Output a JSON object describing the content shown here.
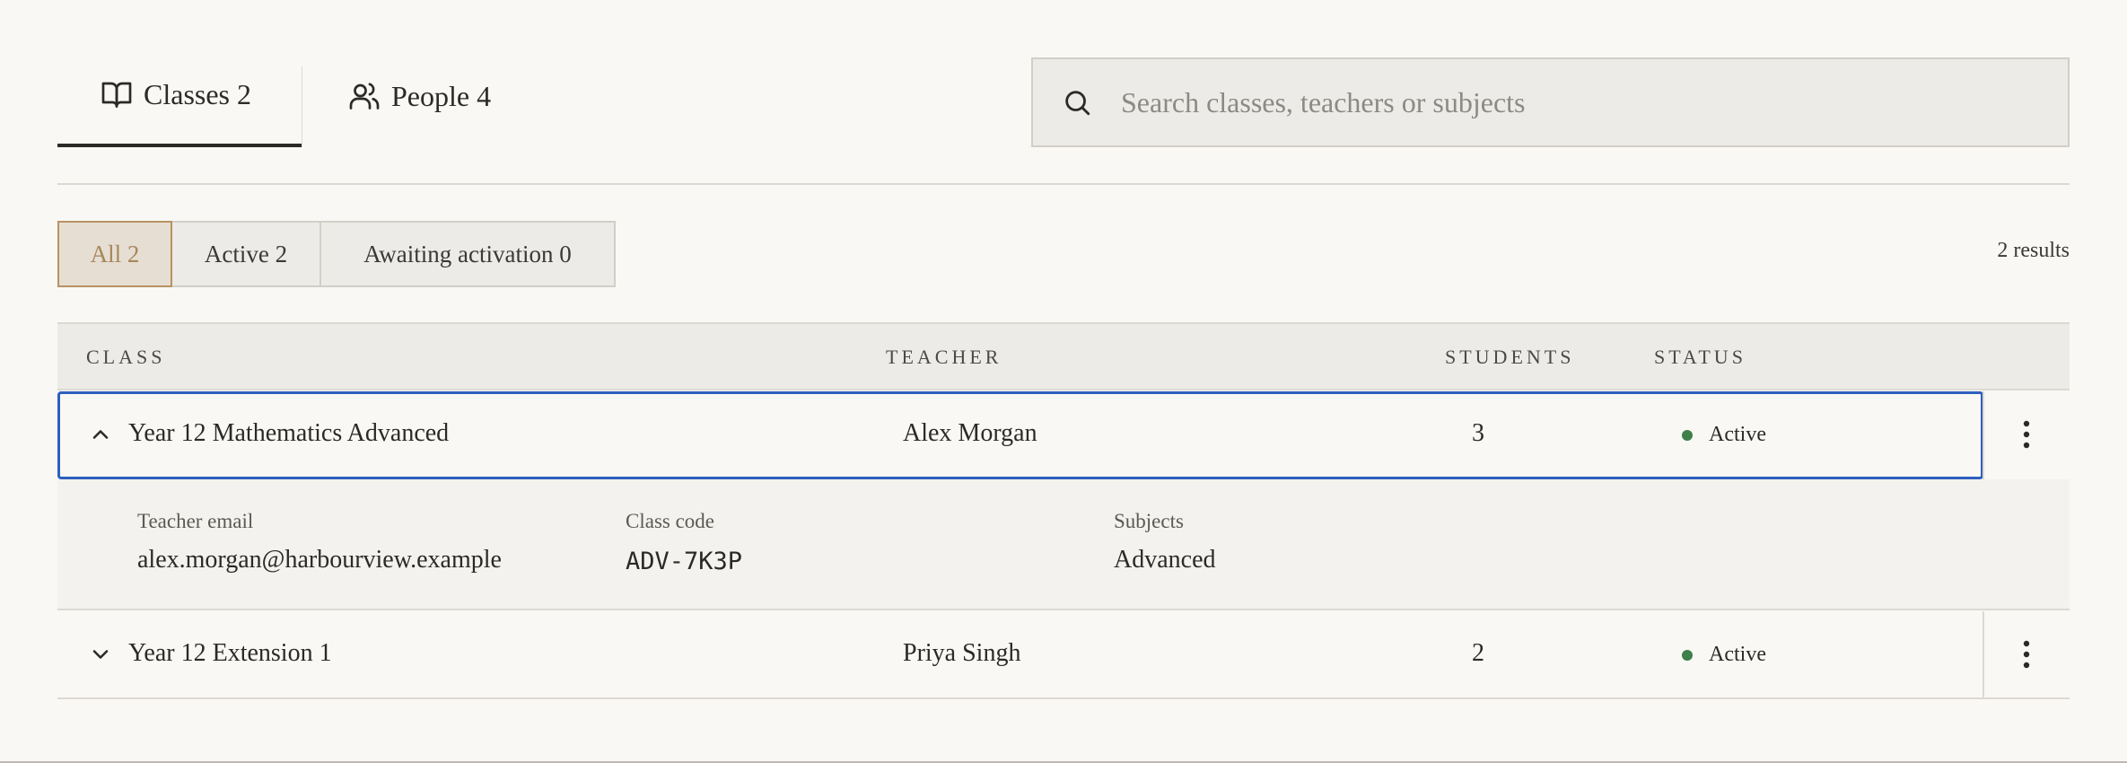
{
  "tabs": [
    {
      "label": "Classes 2",
      "icon": "book-open-icon",
      "active": true
    },
    {
      "label": "People 4",
      "icon": "users-icon",
      "active": false
    }
  ],
  "search": {
    "placeholder": "Search classes, teachers or subjects",
    "value": "",
    "icon": "search-icon"
  },
  "filters": [
    {
      "label": "All 2",
      "selected": true
    },
    {
      "label": "Active 2",
      "selected": false
    },
    {
      "label": "Awaiting activation 0",
      "selected": false
    }
  ],
  "results_text": "2 results",
  "table": {
    "columns": [
      "CLASS",
      "TEACHER",
      "STUDENTS",
      "STATUS"
    ],
    "rows": [
      {
        "class": "Year 12 Mathematics Advanced",
        "teacher": "Alex Morgan",
        "students": "3",
        "status": "Active",
        "expanded": true,
        "details": {
          "teacher_email_label": "Teacher email",
          "teacher_email": "alex.morgan@harbourview.example",
          "class_code_label": "Class code",
          "class_code": "ADV-7K3P",
          "subjects_label": "Subjects",
          "subjects": "Advanced"
        }
      },
      {
        "class": "Year 12 Extension 1",
        "teacher": "Priya Singh",
        "students": "2",
        "status": "Active",
        "expanded": false
      }
    ]
  },
  "colors": {
    "accent_focus": "#2f5fbf",
    "status_active": "#3f7f4a",
    "filter_selected_border": "#b89262",
    "background": "#f9f8f5"
  }
}
